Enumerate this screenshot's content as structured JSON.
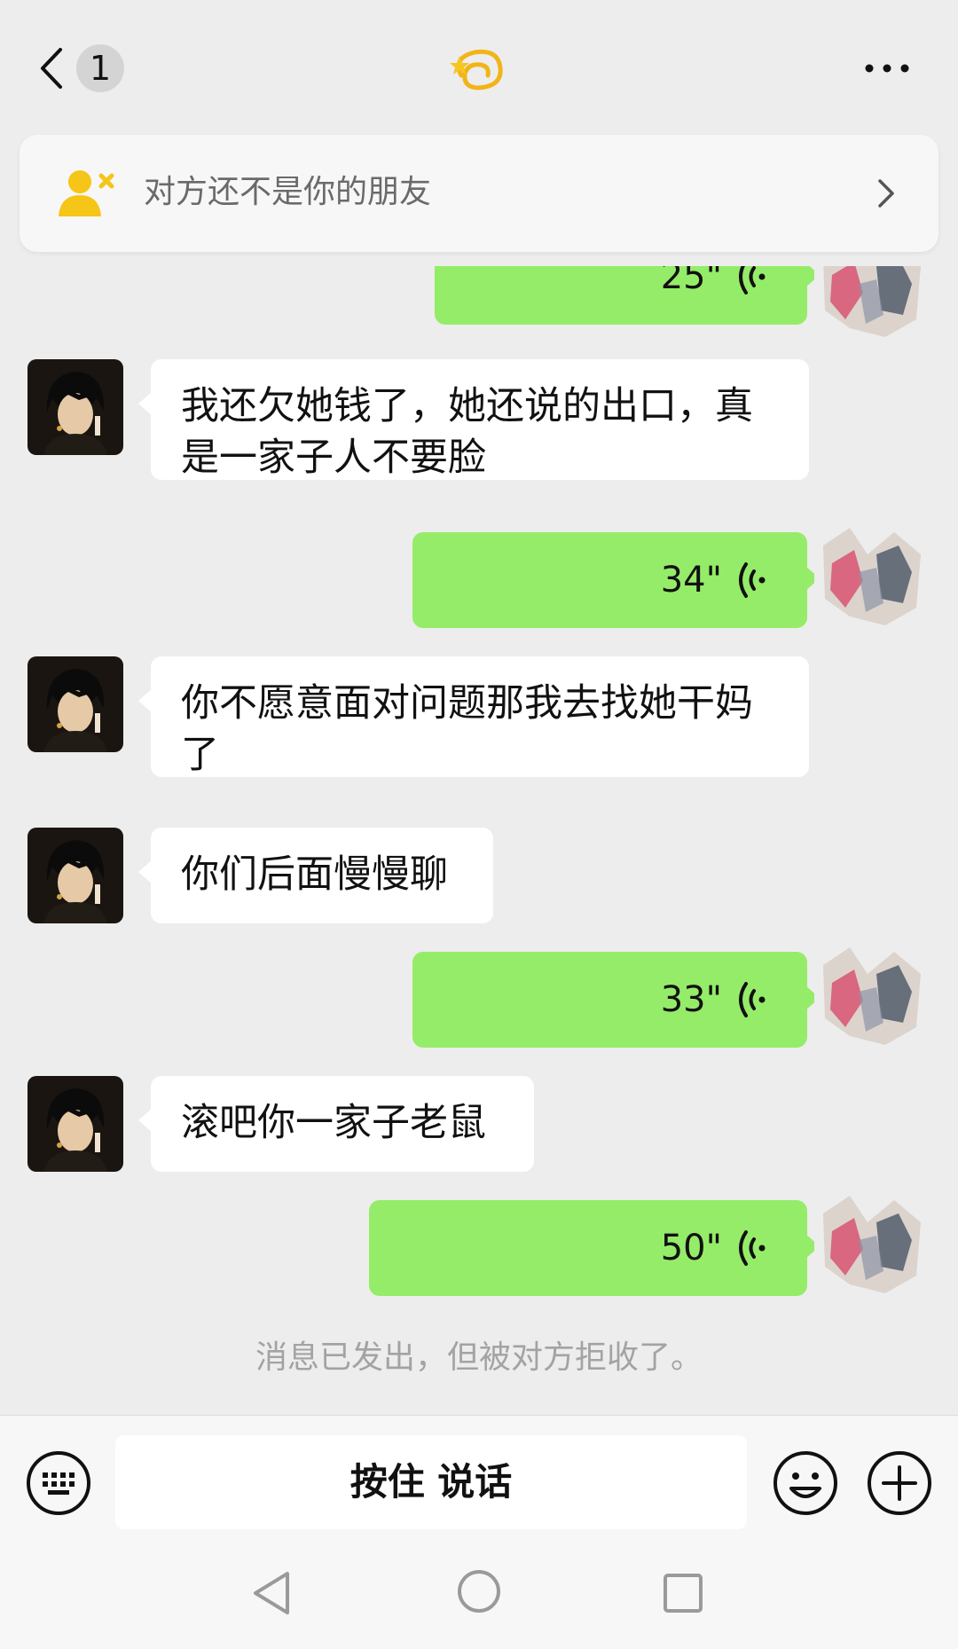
{
  "header": {
    "unread_count": "1",
    "title_emoji": "💫"
  },
  "banner": {
    "text": "对方还不是你的朋友",
    "icon": "person-x-icon"
  },
  "messages": [
    {
      "direction": "out",
      "type": "voice",
      "duration": "25\""
    },
    {
      "direction": "in",
      "type": "text",
      "line1": "我还欠她钱了，她还说的出口，真",
      "line2": "是一家子人不要脸"
    },
    {
      "direction": "out",
      "type": "voice",
      "duration": "34\""
    },
    {
      "direction": "in",
      "type": "text",
      "line1": "你不愿意面对问题那我去找她干妈",
      "line2": "了"
    },
    {
      "direction": "in",
      "type": "text",
      "line1": "你们后面慢慢聊"
    },
    {
      "direction": "out",
      "type": "voice",
      "duration": "33\""
    },
    {
      "direction": "in",
      "type": "text",
      "line1": "滚吧你一家子老鼠"
    },
    {
      "direction": "out",
      "type": "voice",
      "duration": "50\""
    }
  ],
  "system_notice": "消息已发出，但被对方拒收了。",
  "input_bar": {
    "talk_label": "按住 说话"
  },
  "colors": {
    "outgoing_bubble": "#95ec69",
    "incoming_bubble": "#ffffff",
    "background": "#ededed",
    "banner_icon": "#f5c518"
  }
}
